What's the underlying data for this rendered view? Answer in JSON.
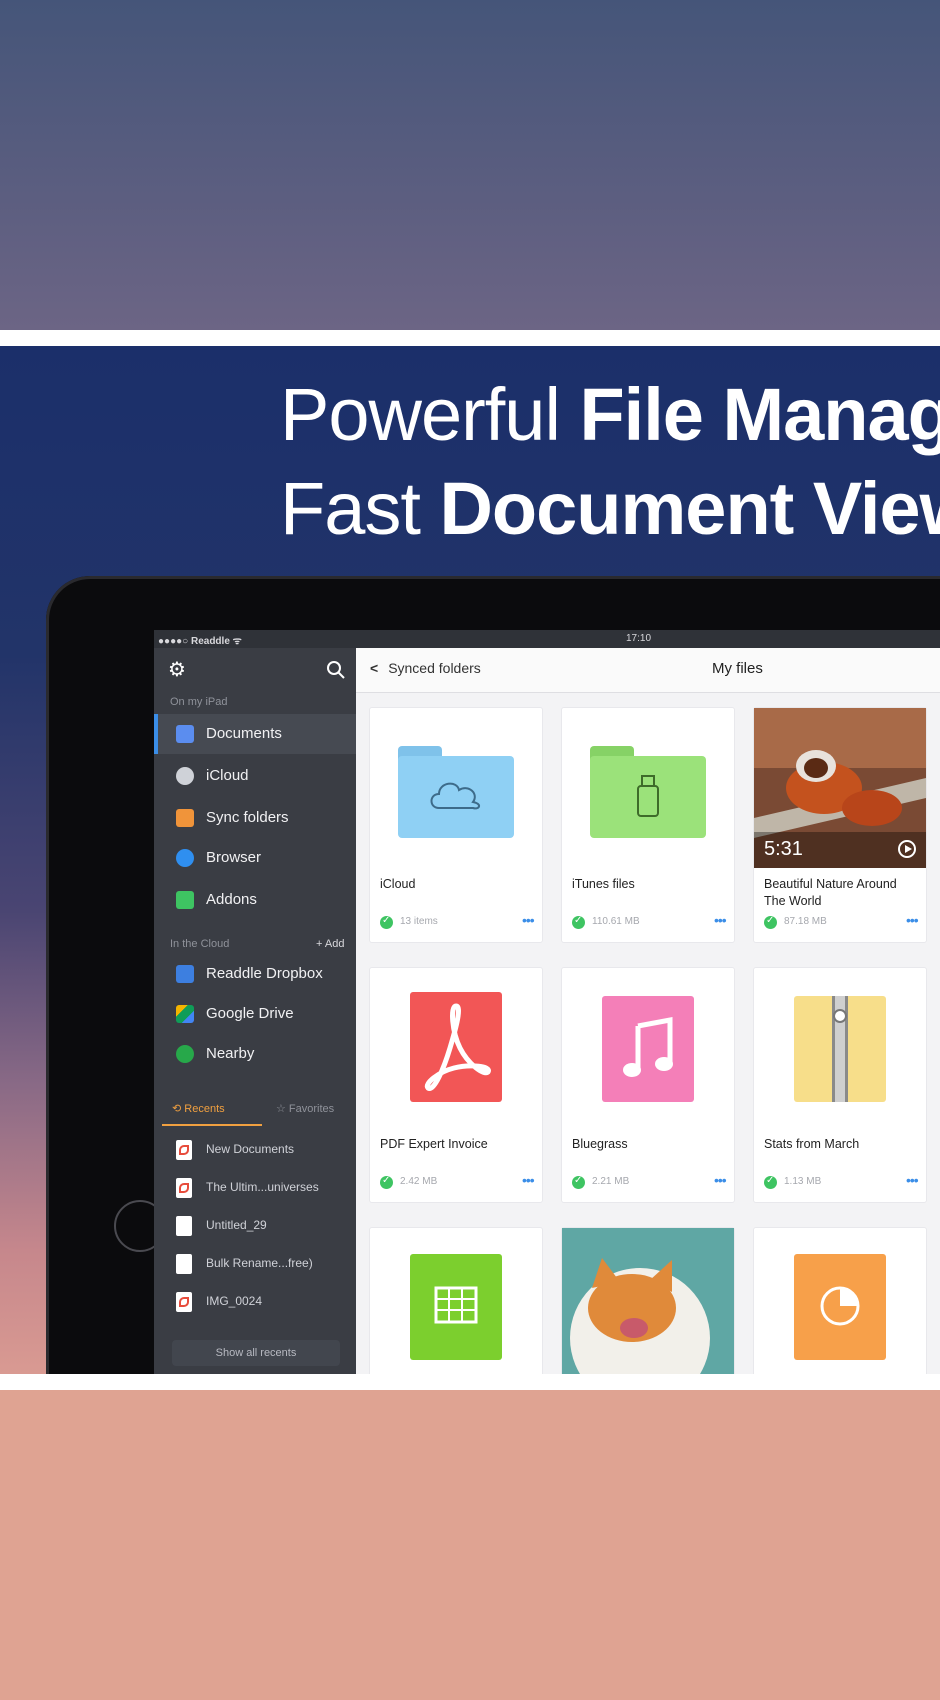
{
  "headline": {
    "line1_light": "Powerful ",
    "line1_bold": "File Manag",
    "line2_light": "Fast ",
    "line2_bold": "Document View"
  },
  "statusbar": {
    "carrier": "●●●●○ Readdle ᯤ",
    "time": "17:10"
  },
  "sidebar": {
    "section_ipad": "On my iPad",
    "items": [
      {
        "label": "Documents",
        "icon": "document-icon",
        "color": "#5b8def"
      },
      {
        "label": "iCloud",
        "icon": "cloud-icon",
        "color": "#cfd2d8"
      },
      {
        "label": "Sync folders",
        "icon": "sync-folder-icon",
        "color": "#f0943a"
      },
      {
        "label": "Browser",
        "icon": "compass-icon",
        "color": "#2f8ff0"
      },
      {
        "label": "Addons",
        "icon": "cart-icon",
        "color": "#3ec462"
      }
    ],
    "section_cloud": "In the Cloud",
    "add_label": "+ Add",
    "cloud_items": [
      {
        "label": "Readdle Dropbox",
        "icon": "dropbox-icon",
        "color": "#3d7fe0"
      },
      {
        "label": "Google Drive",
        "icon": "google-drive-icon",
        "color": "#f4b400"
      },
      {
        "label": "Nearby",
        "icon": "nearby-icon",
        "color": "#27a84a"
      }
    ],
    "tab_recents": "Recents",
    "tab_favorites": "Favorites",
    "recents": [
      {
        "label": "New Documents",
        "type": "pdf"
      },
      {
        "label": "The Ultim...universes",
        "type": "pdf"
      },
      {
        "label": "Untitled_29",
        "type": "doc"
      },
      {
        "label": "Bulk Rename...free)",
        "type": "doc"
      },
      {
        "label": "IMG_0024",
        "type": "pdf"
      }
    ],
    "show_all": "Show all recents"
  },
  "main": {
    "back_label": "Synced folders",
    "title": "My files",
    "cards": [
      {
        "title": "iCloud",
        "meta": "13 items",
        "kind": "folder-cloud",
        "color": "#8fd0f4"
      },
      {
        "title": "iTunes files",
        "meta": "110.61 MB",
        "kind": "folder-usb",
        "color": "#9be27a"
      },
      {
        "title": "Beautiful Nature Around The World",
        "meta": "87.18 MB",
        "kind": "video",
        "duration": "5:31"
      },
      {
        "title": "PDF Expert Invoice",
        "meta": "2.42 MB",
        "kind": "pdf",
        "color": "#f25656"
      },
      {
        "title": "Bluegrass",
        "meta": "2.21 MB",
        "kind": "music",
        "color": "#f47fb8"
      },
      {
        "title": "Stats from March",
        "meta": "1.13 MB",
        "kind": "zip",
        "color": "#f7de8a"
      },
      {
        "title": "",
        "meta": "",
        "kind": "sheet",
        "color": "#7ccf2e"
      },
      {
        "title": "",
        "meta": "",
        "kind": "photo-cat"
      },
      {
        "title": "",
        "meta": "",
        "kind": "slides",
        "color": "#f7a04a"
      }
    ]
  }
}
